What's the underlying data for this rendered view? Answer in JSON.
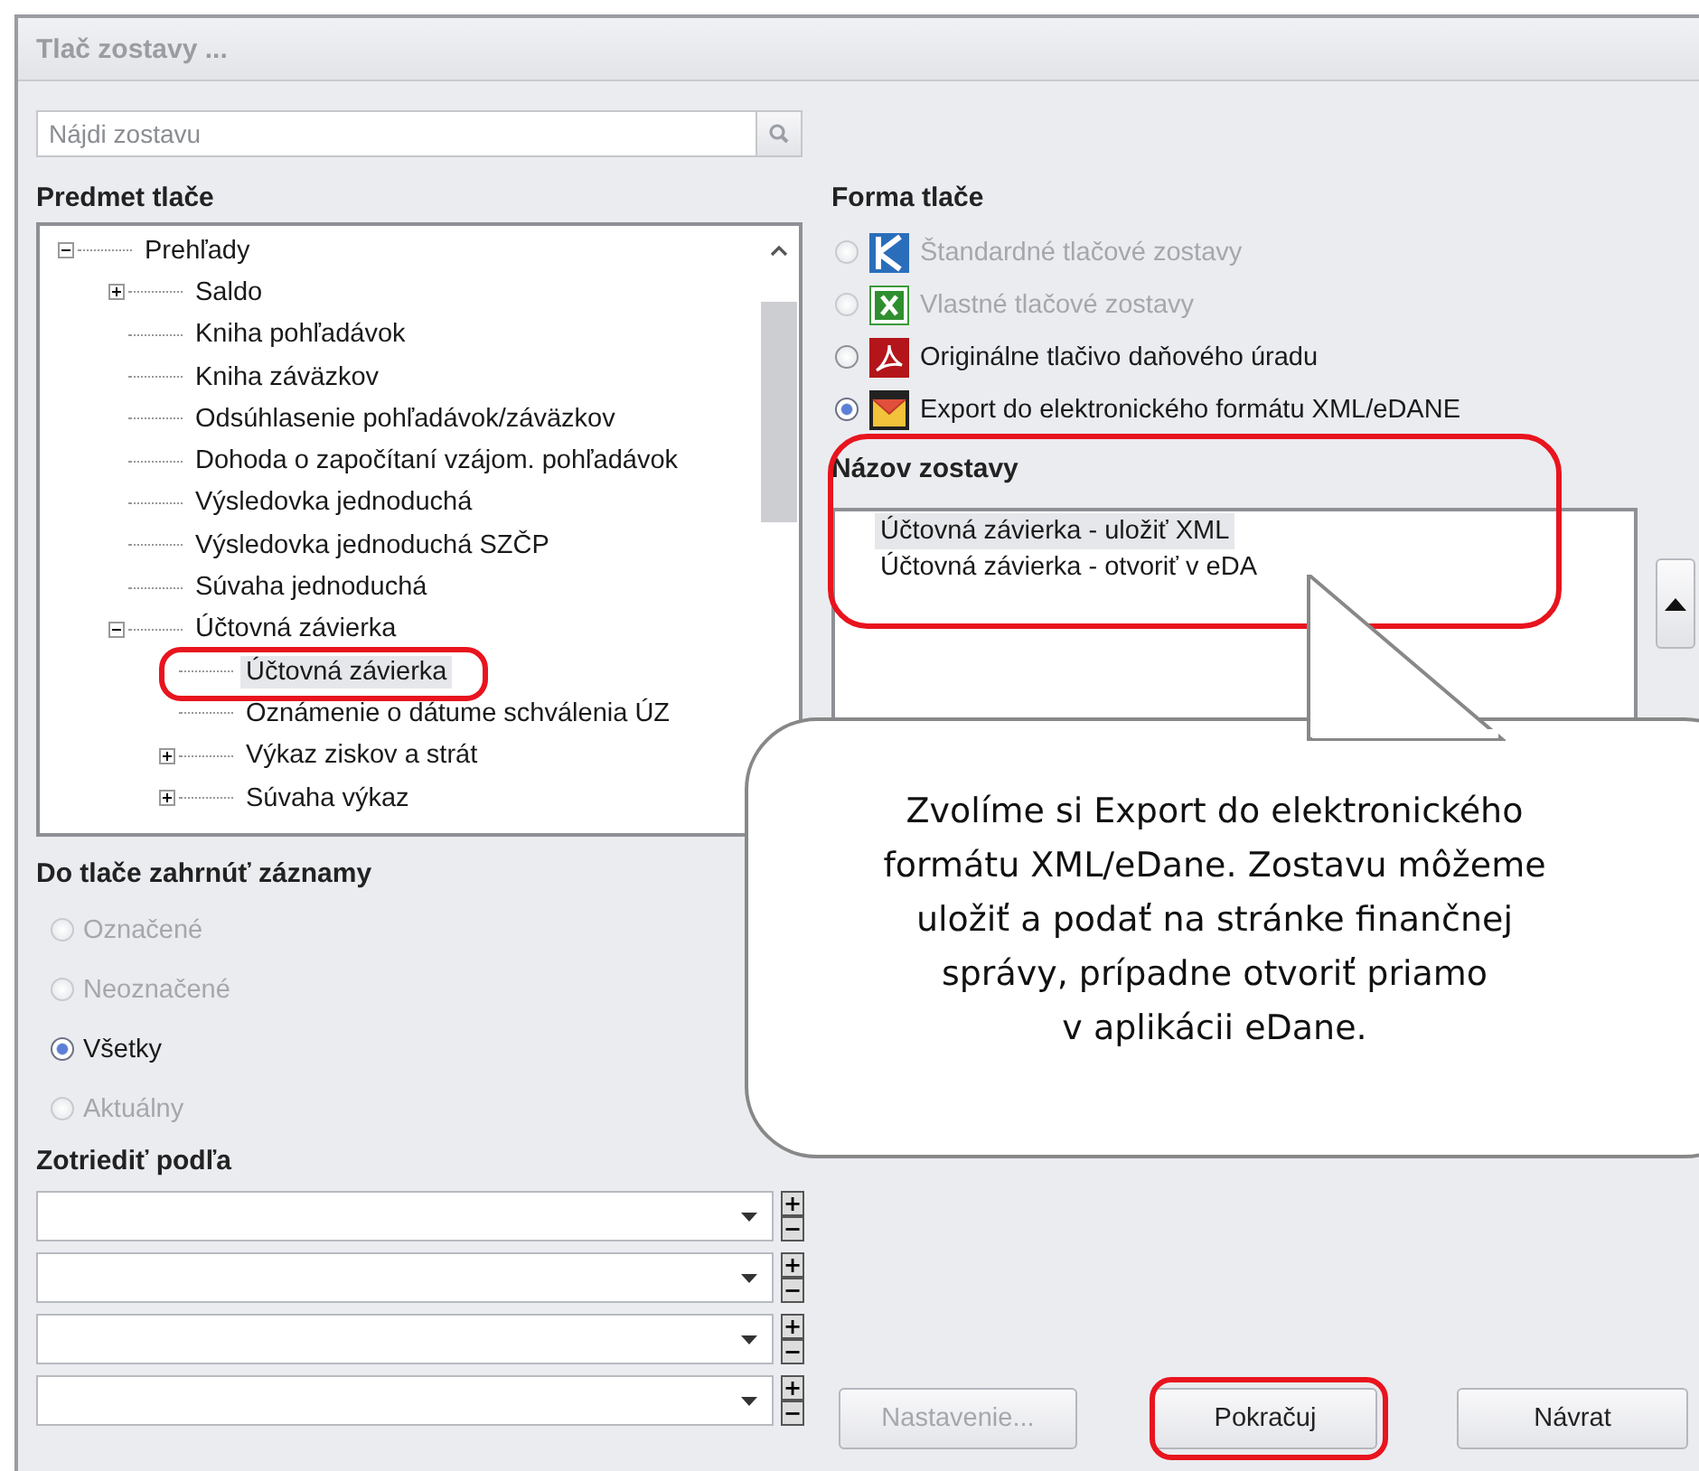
{
  "window": {
    "title": "Tlač zostavy ..."
  },
  "search": {
    "placeholder": "Nájdi zostavu"
  },
  "subject": {
    "heading": "Predmet tlače",
    "tree": [
      {
        "label": "Prehľady",
        "expanded": true,
        "selected": false,
        "children": [
          {
            "label": "Saldo",
            "expanded": false,
            "selected": false
          },
          {
            "label": "Kniha pohľadávok",
            "selected": false
          },
          {
            "label": "Kniha záväzkov",
            "selected": false
          },
          {
            "label": "Odsúhlasenie pohľadávok/záväzkov",
            "selected": false
          },
          {
            "label": "Dohoda o započítaní vzájom. pohľadávok",
            "selected": false
          },
          {
            "label": "Výsledovka jednoduchá",
            "selected": false
          },
          {
            "label": "Výsledovka jednoduchá SZČP",
            "selected": false
          },
          {
            "label": "Súvaha jednoduchá",
            "selected": false
          },
          {
            "label": "Účtovná závierka",
            "expanded": true,
            "selected": false,
            "children": [
              {
                "label": "Účtovná závierka",
                "selected": true
              },
              {
                "label": "Oznámenie o dátume schválenia ÚZ",
                "selected": false
              },
              {
                "label": "Výkaz ziskov a strát",
                "expanded": false,
                "selected": false
              },
              {
                "label": "Súvaha výkaz",
                "expanded": false,
                "selected": false
              }
            ]
          }
        ]
      }
    ]
  },
  "records": {
    "heading": "Do tlače zahrnúť záznamy",
    "options": [
      {
        "label": "Označené",
        "selected": false,
        "disabled": true
      },
      {
        "label": "Neoznačené",
        "selected": false,
        "disabled": true
      },
      {
        "label": "Všetky",
        "selected": true,
        "disabled": false
      },
      {
        "label": "Aktuálny",
        "selected": false,
        "disabled": true
      }
    ]
  },
  "sort": {
    "heading": "Zotriediť podľa",
    "fields": [
      {
        "plus": "+",
        "minus": "−"
      },
      {
        "plus": "+",
        "minus": "−"
      },
      {
        "plus": "+",
        "minus": "−"
      },
      {
        "plus": "+",
        "minus": "−"
      }
    ]
  },
  "print_form": {
    "heading": "Forma tlače",
    "options": [
      {
        "kind": "kros",
        "label": "Štandardné tlačové zostavy",
        "selected": false,
        "disabled": true
      },
      {
        "kind": "excel",
        "label": "Vlastné tlačové zostavy",
        "selected": false,
        "disabled": true
      },
      {
        "kind": "pdf",
        "label": "Originálne tlačivo daňového úradu",
        "selected": false,
        "disabled": false
      },
      {
        "kind": "edane",
        "label": "Export do elektronického formátu XML/eDANE",
        "selected": true,
        "disabled": false
      }
    ]
  },
  "report_name": {
    "heading": "Názov zostavy",
    "items": [
      {
        "label": "Účtovná závierka - uložiť XML",
        "selected": true
      },
      {
        "label": "Účtovná závierka - otvoriť v eDA",
        "selected": false
      }
    ]
  },
  "callout": {
    "text": "Zvolíme si Export do elektronického\nformátu XML/eDane. Zostavu môžeme\nuložiť a podať na stránke finančnej\nsprávy, prípadne otvoriť priamo\nv aplikácii eDane."
  },
  "buttons": [
    {
      "label": "Nastavenie...",
      "disabled": true
    },
    {
      "label": "Pokračuj",
      "disabled": false
    },
    {
      "label": "Návrat",
      "disabled": false
    }
  ]
}
